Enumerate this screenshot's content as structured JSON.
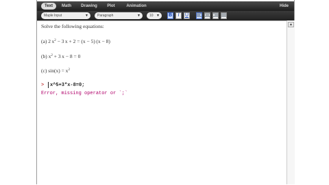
{
  "tabs": [
    {
      "label": "Text",
      "active": true
    },
    {
      "label": "Math",
      "active": false
    },
    {
      "label": "Drawing",
      "active": false
    },
    {
      "label": "Plot",
      "active": false
    },
    {
      "label": "Animation",
      "active": false
    }
  ],
  "hide_label": "Hide",
  "toolbar": {
    "style_select": "Maple Input",
    "paragraph_select": "Paragraph",
    "size_select": "10",
    "bold": "B",
    "italic": "I",
    "underline": "U"
  },
  "document": {
    "heading": "Solve the following equations:",
    "eq_a": {
      "prefix": "(a) 2 x",
      "sup": "2",
      "rest": " − 3 x + 2 = (x − 5) (x − 8)"
    },
    "eq_b": {
      "prefix": "(b) x",
      "sup": "2",
      "rest": " + 3 x − 8 = 0"
    },
    "eq_c": {
      "prefix": "(c) sin(x) = x",
      "sup": "2",
      "rest": ""
    },
    "prompt": ">",
    "input": "x^5+3*x-8=0;",
    "error": "Error, missing operator or `;`"
  },
  "colors": {
    "tabbar": "#2b2b2b",
    "prompt": "#b00000",
    "error": "#b0006a"
  }
}
